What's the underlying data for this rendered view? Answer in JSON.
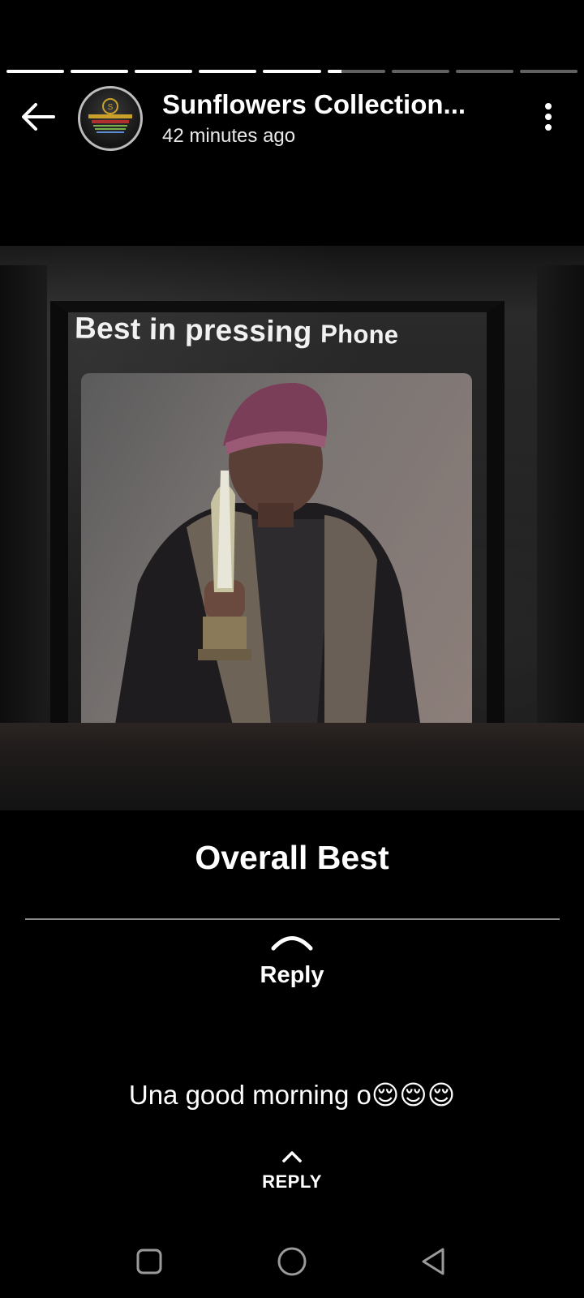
{
  "story": {
    "segments_total": 9,
    "segments_completed": 5,
    "current_segment_progress": 0.25
  },
  "header": {
    "title": "Sunflowers Collection...",
    "time": "42 minutes ago",
    "avatar_icon": "brand-logo-icon"
  },
  "media": {
    "frame_text_main": "Best in pressing ",
    "frame_text_small": "Phone",
    "caption": "Overall Best"
  },
  "reply": {
    "label": "Reply"
  },
  "status": {
    "text": "Una good morning o😌😌😌"
  },
  "reply_bottom": {
    "label": "REPLY"
  },
  "navbar": {
    "icons": [
      "recent-apps-icon",
      "home-icon",
      "back-triangle-icon"
    ]
  }
}
